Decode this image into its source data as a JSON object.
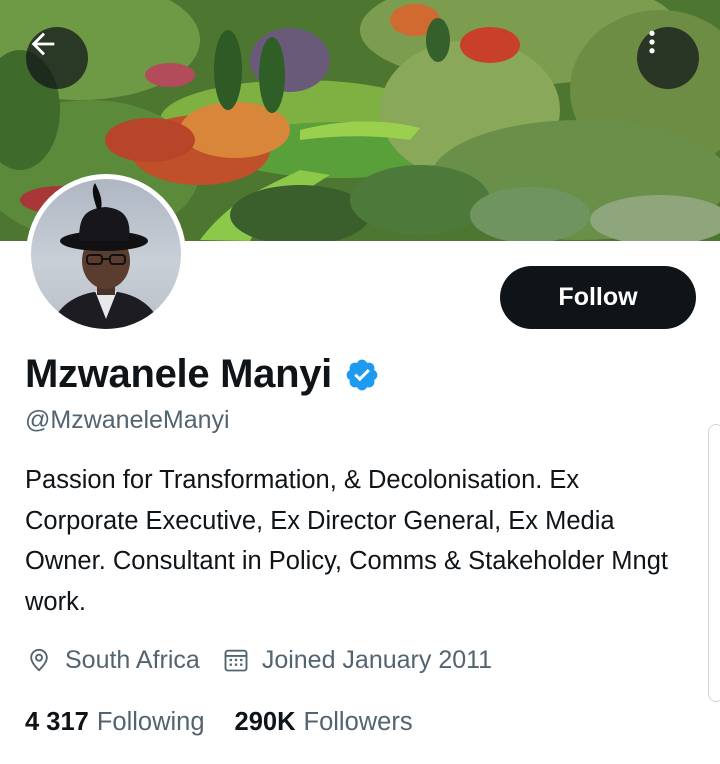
{
  "header": {
    "back_icon": "arrow-left-icon",
    "more_icon": "more-vertical-icon"
  },
  "profile": {
    "display_name": "Mzwanele Manyi",
    "verified_icon": "verified-badge-icon",
    "handle": "@MzwaneleManyi",
    "follow_label": "Follow",
    "bio": "Passion for Transformation, & Decolonisation. Ex Corporate Executive, Ex Director General, Ex Media Owner. Consultant in Policy, Comms & Stakeholder Mngt work.",
    "location": "South Africa",
    "location_icon": "location-pin-icon",
    "joined": "Joined January 2011",
    "joined_icon": "calendar-icon",
    "following_count": "4 317",
    "following_label": "Following",
    "followers_count": "290K",
    "followers_label": "Followers"
  },
  "colors": {
    "text_primary": "#0f1419",
    "text_secondary": "#536471",
    "verified_blue": "#1d9bf0",
    "follow_button_bg": "#0f1419"
  }
}
